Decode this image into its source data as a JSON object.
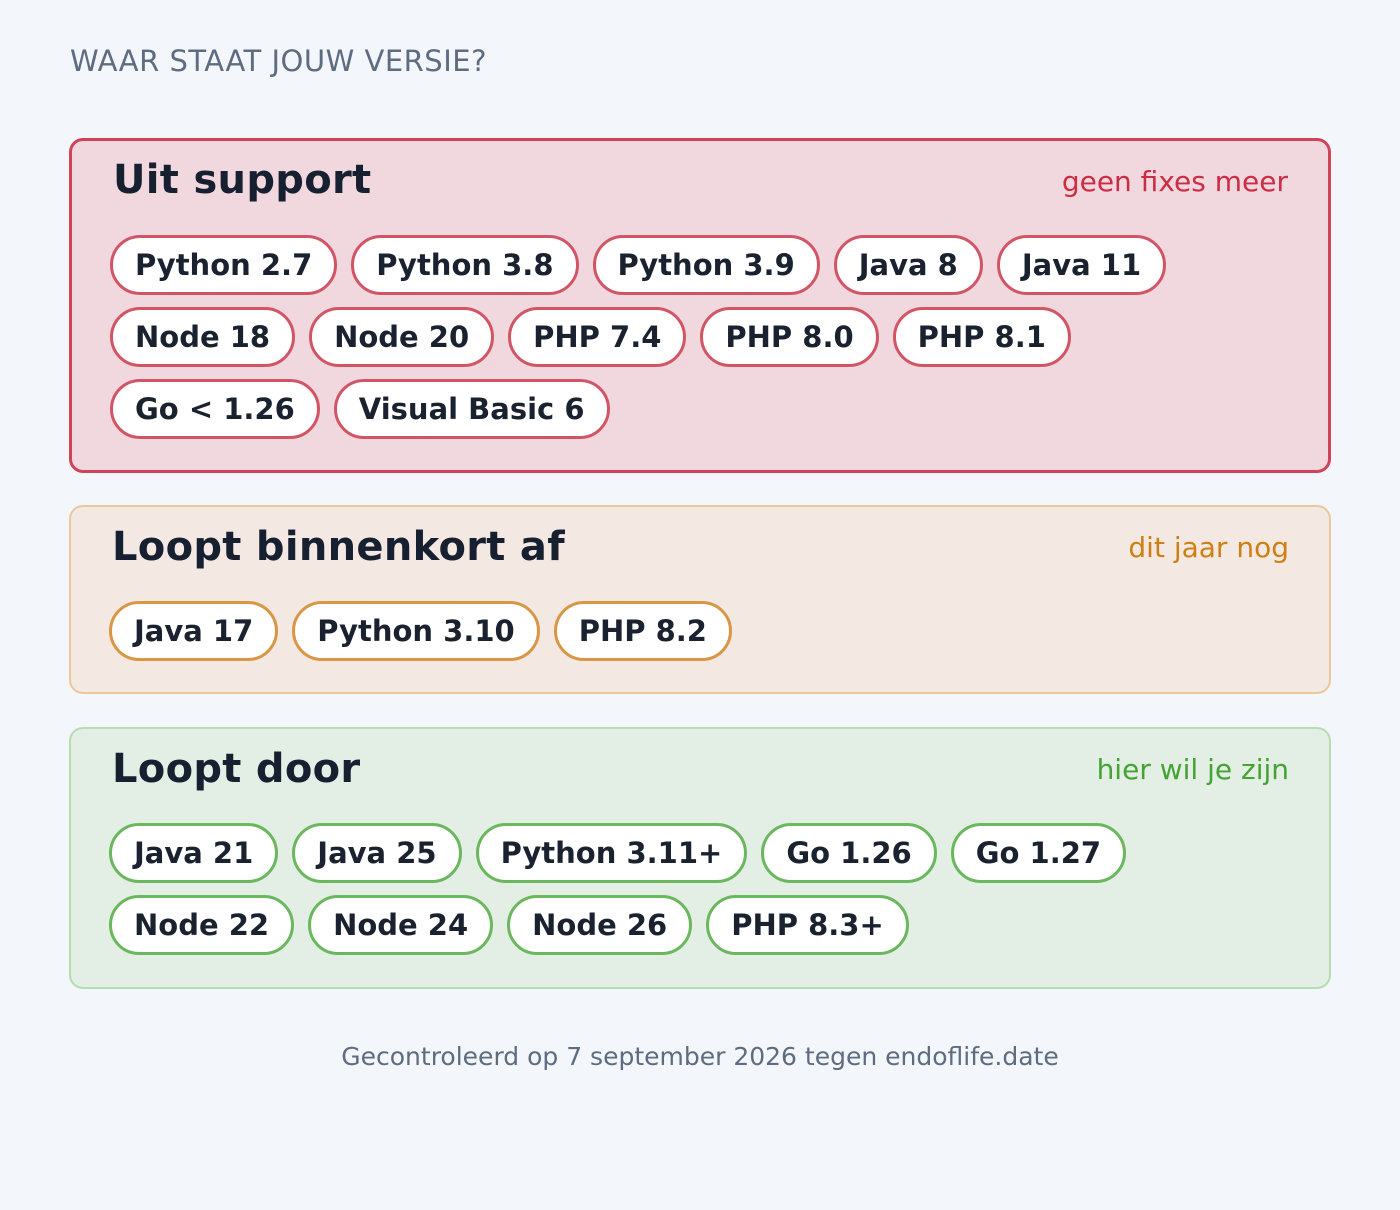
{
  "header": {
    "title": "WAAR STAAT JOUW VERSIE?"
  },
  "sections": [
    {
      "title": "Uit support",
      "note": "geen fixes meer",
      "color": "#cf4458",
      "items": [
        "Python 2.7",
        "Python 3.8",
        "Python 3.9",
        "Java 8",
        "Java 11",
        "Node 18",
        "Node 20",
        "PHP 7.4",
        "PHP 8.0",
        "PHP 8.1",
        "Go < 1.26",
        "Visual Basic 6"
      ]
    },
    {
      "title": "Loopt binnenkort af",
      "note": "dit jaar nog",
      "color": "#d99645",
      "items": [
        "Java 17",
        "Python 3.10",
        "PHP 8.2"
      ]
    },
    {
      "title": "Loopt door",
      "note": "hier wil je zijn",
      "color": "#6ab75e",
      "items": [
        "Java 21",
        "Java 25",
        "Python 3.11+",
        "Go 1.26",
        "Go 1.27",
        "Node 22",
        "Node 24",
        "Node 26",
        "PHP 8.3+"
      ]
    }
  ],
  "footer": {
    "text": "Gecontroleerd op 7 september 2026 tegen endoflife.date"
  }
}
